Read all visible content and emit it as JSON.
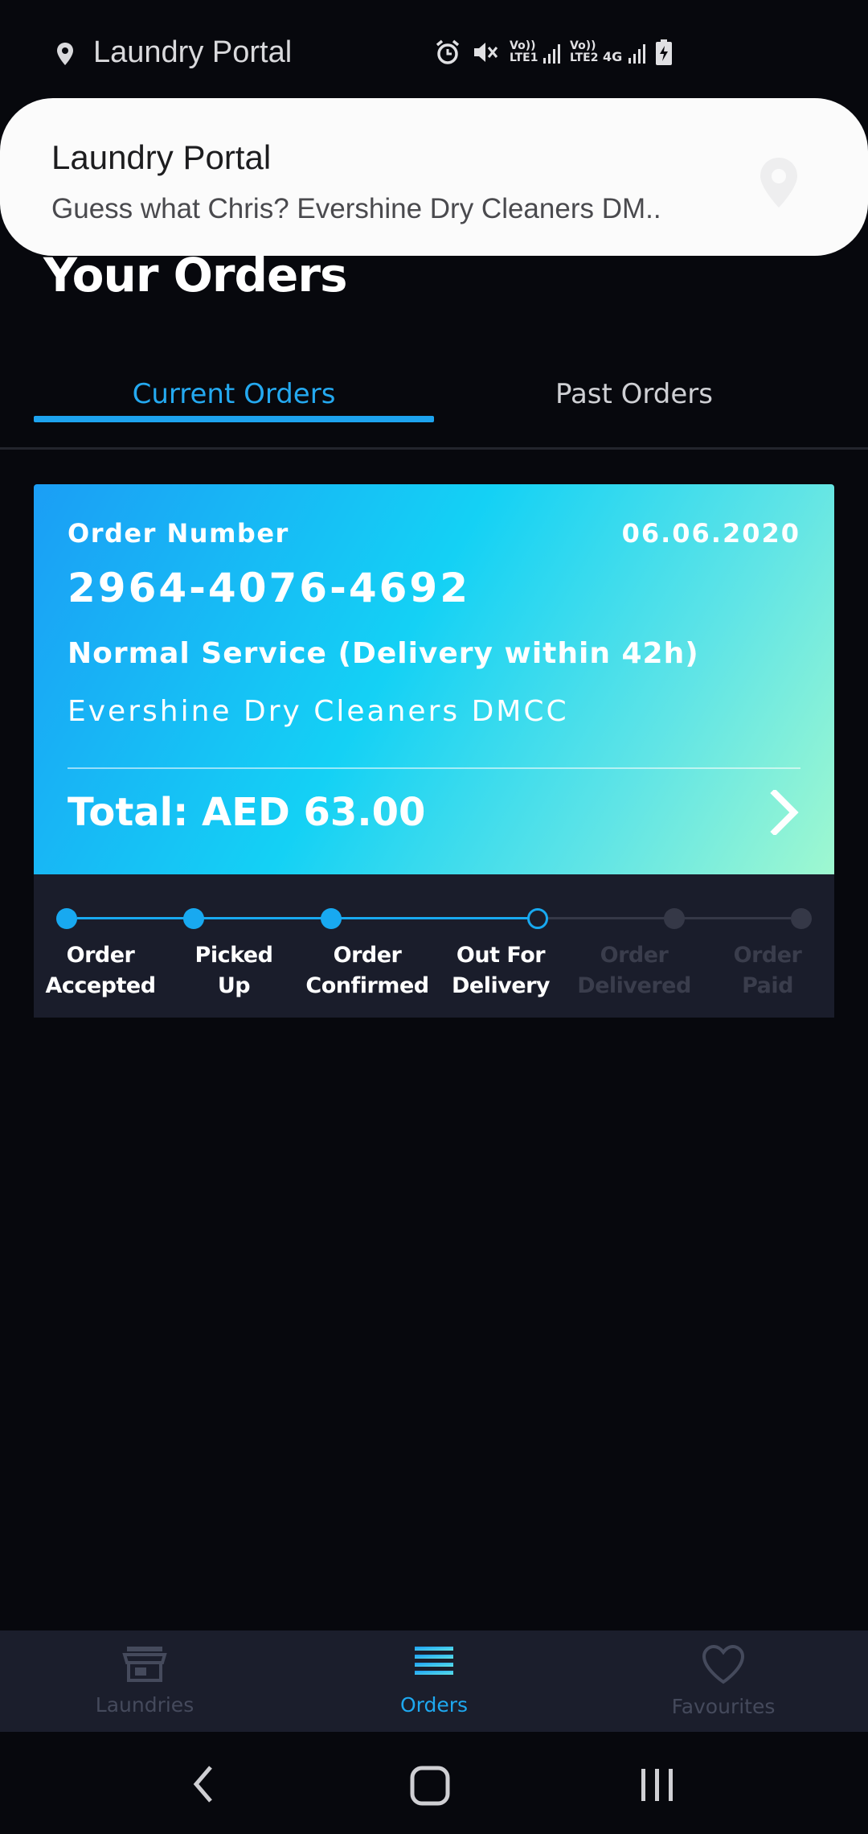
{
  "status_bar": {
    "app_name": "Laundry Portal",
    "network_labels": [
      "Vo)) LTE1",
      "Vo)) LTE2",
      "4G"
    ]
  },
  "notification": {
    "title": "Laundry Portal",
    "body": "Guess what Chris? Evershine Dry Cleaners DM.."
  },
  "page": {
    "title": "Your Orders"
  },
  "tabs": {
    "current": "Current Orders",
    "past": "Past Orders",
    "active": "current"
  },
  "order": {
    "number_label": "Order Number",
    "date": "06.06.2020",
    "number": "2964-4076-4692",
    "service": "Normal Service (Delivery within 42h)",
    "shop": "Evershine Dry Cleaners DMCC",
    "total": "Total: AED 63.00"
  },
  "tracker": {
    "steps": [
      {
        "line1": "Order",
        "line2": "Accepted",
        "state": "done"
      },
      {
        "line1": "Picked",
        "line2": "Up",
        "state": "done"
      },
      {
        "line1": "Order",
        "line2": "Confirmed",
        "state": "done"
      },
      {
        "line1": "Out For",
        "line2": "Delivery",
        "state": "current"
      },
      {
        "line1": "Order",
        "line2": "Delivered",
        "state": "pending"
      },
      {
        "line1": "Order",
        "line2": "Paid",
        "state": "pending"
      }
    ]
  },
  "bottom_nav": {
    "laundries": "Laundries",
    "orders": "Orders",
    "favourites": "Favourites",
    "active": "orders"
  },
  "colors": {
    "accent": "#1da3ee",
    "background": "#07080d",
    "card_gradient_start": "#1b9ef5",
    "card_gradient_end": "#9ff8d0",
    "tracker_bg": "#1a1d2b"
  }
}
